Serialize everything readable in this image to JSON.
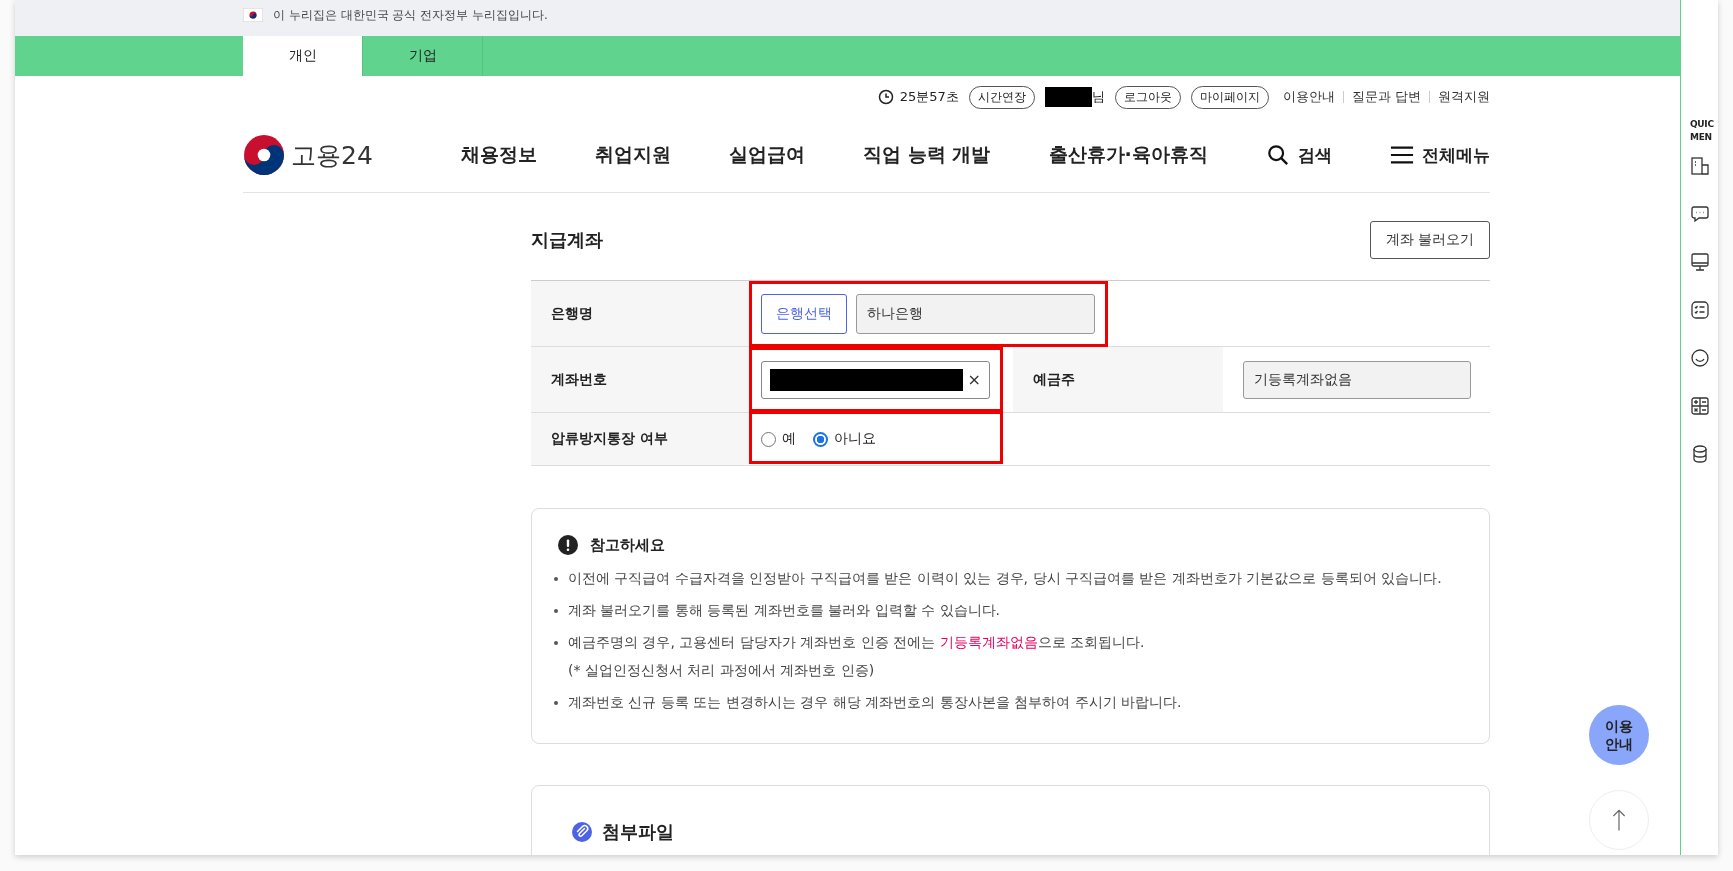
{
  "gov_banner": {
    "text": "이 누리집은 대한민국 공식 전자정부 누리집입니다."
  },
  "audience_tabs": [
    {
      "label": "개인",
      "selected": true
    },
    {
      "label": "기업",
      "selected": false
    }
  ],
  "utility_bar": {
    "session_time": "25분57초",
    "extend_button": "시간연장",
    "user_suffix": "님",
    "logout_button": "로그아웃",
    "mypage_button": "마이페이지",
    "links": [
      "이용안내",
      "질문과 답변",
      "원격지원"
    ]
  },
  "header": {
    "logo_text": "고용24",
    "nav": [
      "채용정보",
      "취업지원",
      "실업급여",
      "직업 능력 개발",
      "출산휴가·육아휴직"
    ],
    "search": "검색",
    "all_menu": "전체메뉴"
  },
  "section": {
    "title": "지급계좌",
    "load_button": "계좌 불러오기"
  },
  "form": {
    "bank_label": "은행명",
    "bank_select_button": "은행선택",
    "bank_value": "하나은행",
    "account_label": "계좌번호",
    "clear_symbol": "×",
    "holder_label": "예금주",
    "holder_value": "기등록계좌없음",
    "protect_label": "압류방지통장 여부",
    "protect_options": [
      {
        "label": "예",
        "selected": false
      },
      {
        "label": "아니요",
        "selected": true
      }
    ]
  },
  "notice": {
    "title": "참고하세요",
    "items": [
      {
        "parts": [
          {
            "text": "이전에 구직급여 수급자격을 인정받아 구직급여를 받은 이력이 있는 경우, 당시 구직급여를 받은 계좌번호가 기본값으로 등록되어 있습니다.",
            "highlight": false
          }
        ]
      },
      {
        "parts": [
          {
            "text": "계좌 불러오기를 통해 등록된 계좌번호를 불러와 입력할 수 있습니다.",
            "highlight": false
          }
        ]
      },
      {
        "parts": [
          {
            "text": "예금주명의 경우, 고용센터 담당자가 계좌번호 인증 전에는 ",
            "highlight": false
          },
          {
            "text": "기등록계좌없음",
            "highlight": true
          },
          {
            "text": "으로 조회됩니다.",
            "highlight": false
          }
        ],
        "note": "(* 실업인정신청서 처리 과정에서 계좌번호 인증)"
      },
      {
        "parts": [
          {
            "text": "계좌번호 신규 등록 또는 변경하시는 경우 해당 계좌번호의 통장사본을 첨부하여 주시기 바랍니다.",
            "highlight": false
          }
        ]
      }
    ]
  },
  "attachments": {
    "title": "첨부파일"
  },
  "quick_menu": {
    "title_lines": [
      "QUIC",
      "MEN"
    ]
  },
  "floating": {
    "guide_lines": [
      "이용",
      "안내"
    ]
  }
}
